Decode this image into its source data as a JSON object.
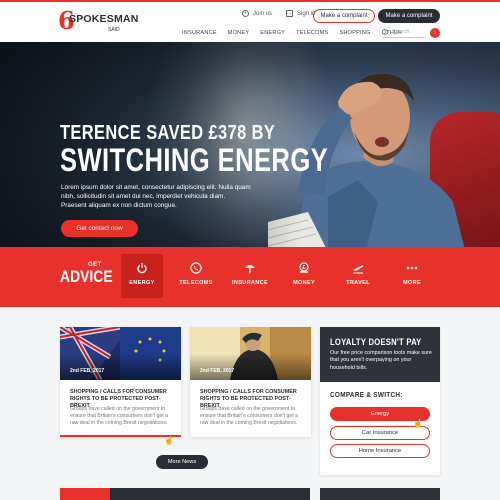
{
  "brand": {
    "logo_mark": "6",
    "name": "SPOKESMAN",
    "tagline": "SAID"
  },
  "top_links": [
    {
      "label": "Join us",
      "icon": "join-icon"
    },
    {
      "label": "Sign in",
      "icon": "sign-in-icon"
    }
  ],
  "buttons": {
    "complaint_outline": "Make a complaint",
    "complaint_dark": "Make a complaint"
  },
  "nav": [
    "INSURANCE",
    "MONEY",
    "ENERGY",
    "TELECOMS",
    "SHOPPING",
    "OTHER"
  ],
  "search": {
    "placeholder": "Search"
  },
  "hero": {
    "title_line1": "TERENCE SAVED £378 BY",
    "title_line2": "SWITCHING ENERGY",
    "text": "Lorem ipsum dolor sit amet, consectetur adipiscing elit. Nulla quam nibh, sollicitudin sit amet dui nec, imperdiet vehicula diam. Praesent aliquam ex non dictum congue.",
    "cta": "Get contact now",
    "slides": 4,
    "active_slide": 1
  },
  "advice": {
    "get": "GET",
    "word": "ADVICE",
    "items": [
      {
        "label": "ENERGY",
        "icon": "power-icon",
        "active": true
      },
      {
        "label": "TELECOMS",
        "icon": "phone-icon",
        "active": false
      },
      {
        "label": "INSURANCE",
        "icon": "umbrella-icon",
        "active": false
      },
      {
        "label": "MONEY",
        "icon": "money-icon",
        "active": false
      },
      {
        "label": "TRAVEL",
        "icon": "plane-icon",
        "active": false
      },
      {
        "label": "MORE",
        "icon": "more-icon",
        "active": false
      }
    ]
  },
  "articles": [
    {
      "date": "2nd FEB, 2017",
      "category": "SHOPPING / CALLS FOR CONSUMER RIGHTS TO BE PROTECTED POST-BREXIT",
      "body": "Groups have called on the government to ensure that Britain's consumers don't get a raw deal in the coming Brexit negotiations."
    },
    {
      "date": "2nd FEB, 2017",
      "category": "SHOPPING / CALLS FOR CONSUMER RIGHTS TO BE PROTECTED POST-BREXIT",
      "body": "Groups have called on the government to ensure that Britain's consumers don't get a raw deal in the coming Brexit negotiations."
    }
  ],
  "more_news": "More News",
  "sidebar": {
    "title": "LOYALTY DOESN'T PAY",
    "text": "Our free price comparison tools make sure that you aren't overpaying on your household bills.",
    "compare_title": "COMPARE & SWITCH:",
    "options": [
      {
        "label": "Energy",
        "selected": true
      },
      {
        "label": "Car Insurance",
        "selected": false
      },
      {
        "label": "Home Insurance",
        "selected": false
      }
    ]
  },
  "colors": {
    "accent": "#e8312a",
    "dark": "#2a2d33",
    "panel": "#2f3238",
    "bg": "#f4f5f7"
  }
}
